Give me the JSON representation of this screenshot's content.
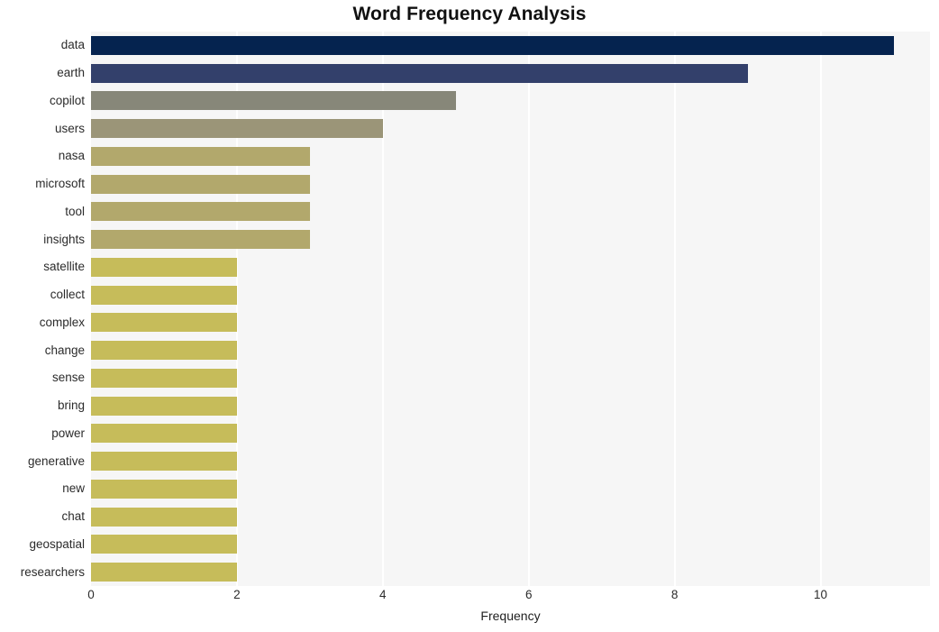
{
  "chart_data": {
    "type": "bar",
    "orientation": "horizontal",
    "title": "Word Frequency Analysis",
    "xlabel": "Frequency",
    "ylabel": "",
    "xlim": [
      0,
      11.5
    ],
    "xticks": [
      "0",
      "2",
      "4",
      "6",
      "8",
      "10"
    ],
    "xtick_values": [
      0,
      2,
      4,
      6,
      8,
      10
    ],
    "grid": "vertical",
    "legend": "none",
    "categories": [
      "data",
      "earth",
      "copilot",
      "users",
      "nasa",
      "microsoft",
      "tool",
      "insights",
      "satellite",
      "collect",
      "complex",
      "change",
      "sense",
      "bring",
      "power",
      "generative",
      "new",
      "chat",
      "geospatial",
      "researchers"
    ],
    "values": [
      11,
      9,
      5,
      4,
      3,
      3,
      3,
      3,
      2,
      2,
      2,
      2,
      2,
      2,
      2,
      2,
      2,
      2,
      2,
      2
    ],
    "bar_colors": [
      "#05234f",
      "#33406b",
      "#878779",
      "#9b9578",
      "#b2a86c",
      "#b2a86c",
      "#b2a86c",
      "#b2a86c",
      "#c6bc5a",
      "#c6bc5a",
      "#c6bc5a",
      "#c6bc5a",
      "#c6bc5a",
      "#c6bc5a",
      "#c6bc5a",
      "#c6bc5a",
      "#c6bc5a",
      "#c6bc5a",
      "#c6bc5a",
      "#c6bc5a"
    ]
  },
  "style": {
    "plot_background": "#f6f6f6",
    "figure_background": "#ffffff",
    "gridline_color": "#ffffff",
    "text_color": "#2b2b2b"
  }
}
